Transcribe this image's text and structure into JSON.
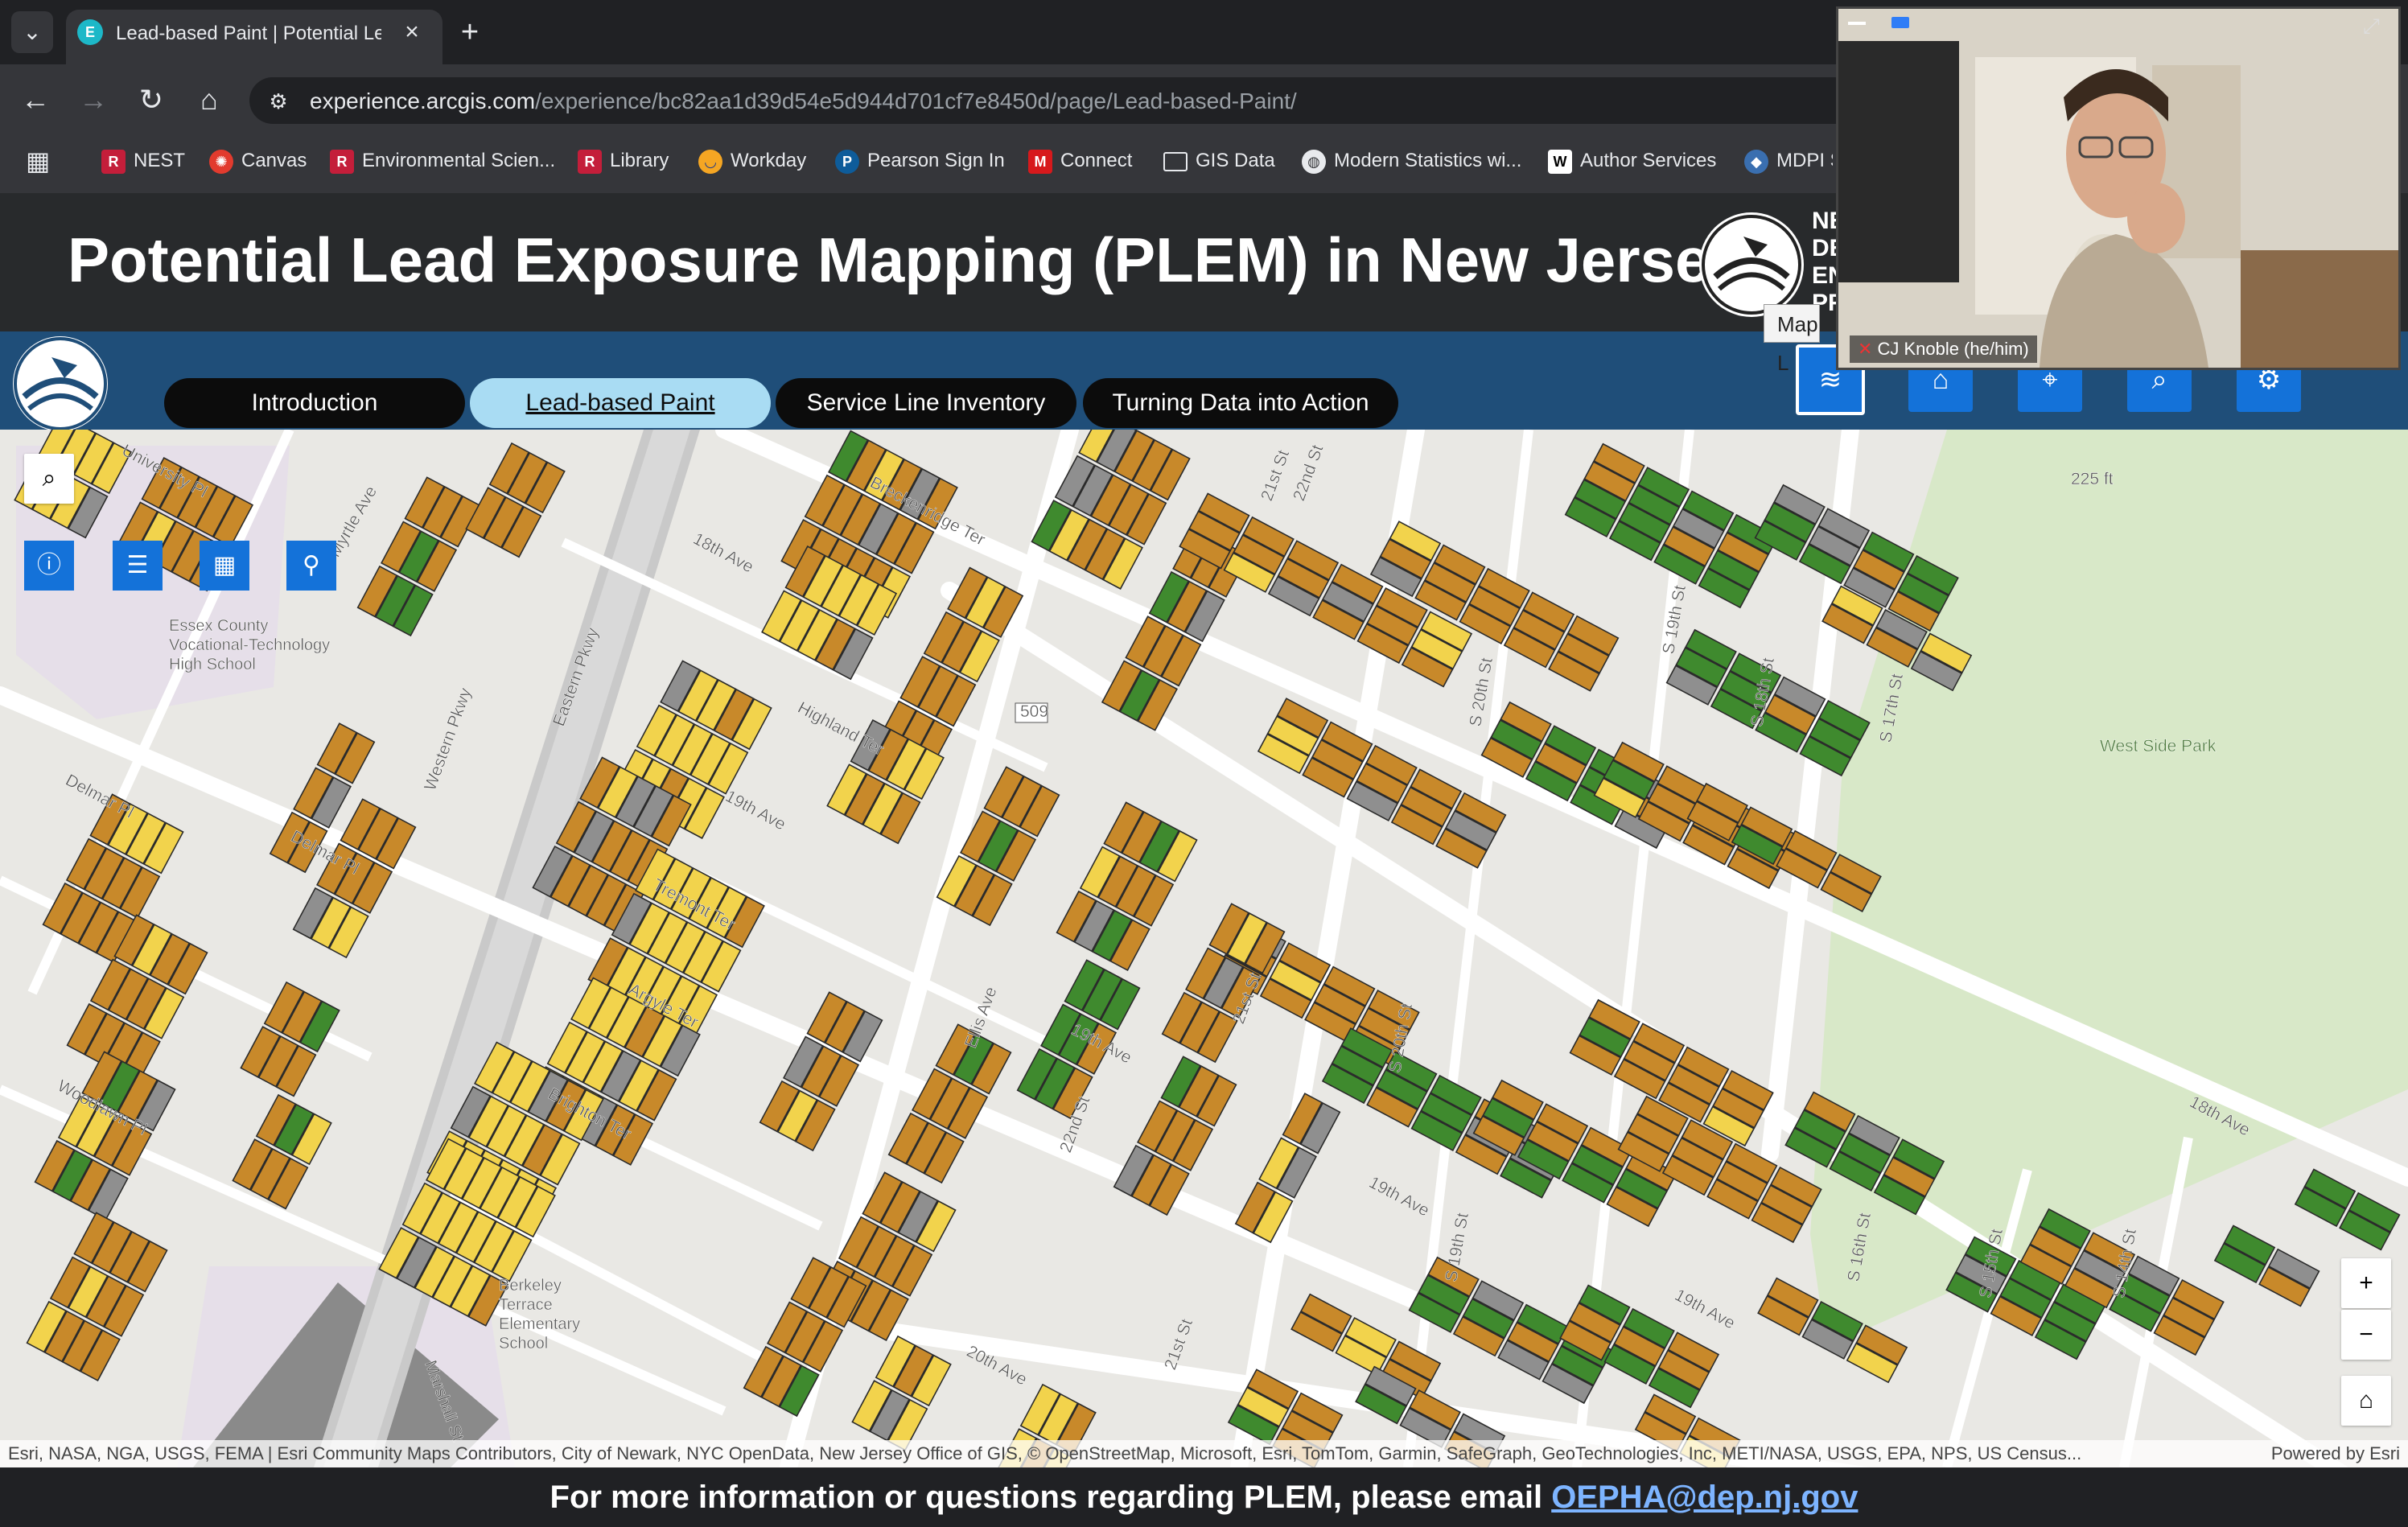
{
  "browser": {
    "tab_title": "Lead-based Paint | Potential Lea",
    "url_host": "experience.arcgis.com",
    "url_path": "/experience/bc82aa1d39d54e5d944d701cf7e8450d/page/Lead-based-Paint/",
    "bookmarks": [
      "NEST",
      "Canvas",
      "Environmental Scien...",
      "Library",
      "Workday",
      "Pearson Sign In",
      "Connect",
      "GIS Data",
      "Modern Statistics wi...",
      "Author Services",
      "MDPI S"
    ]
  },
  "app": {
    "title": "Potential Lead Exposure Mapping (PLEM) in New Jersey",
    "logo_text": [
      "NE",
      "DE",
      "EN",
      "PR"
    ],
    "tabs": [
      "Introduction",
      "Lead-based Paint",
      "Service Line Inventory",
      "Turning Data into Action"
    ],
    "tooltip": "Map L"
  },
  "map": {
    "labels": [
      "University Pl",
      "Myrtle Ave",
      "Essex County Vocational-Technology High School",
      "18th Ave",
      "Breckenridge Ter",
      "Highland Ter",
      "Eastern Pkwy",
      "Western Pkwy",
      "Delmar Pl",
      "Delmar Pl",
      "19th Ave",
      "Tremont Ter",
      "Argyle Ter",
      "Brighton Ter",
      "Woodlawn Pl",
      "Berkeley Terrace Elementary School",
      "Marshall St",
      "20th Ave",
      "Ellis Ave",
      "19th Ave",
      "22nd St",
      "21st St",
      "21st St",
      "S 20th St",
      "S 20th St",
      "19th Ave",
      "S 19th St",
      "22nd St",
      "21st St",
      "S 19th St",
      "S 18th St",
      "S 17th St",
      "West Side Park",
      "225 ft",
      "18th Ave",
      "19th Ave",
      "S 16th St",
      "S 15th St",
      "S 14th St",
      "509"
    ],
    "attribution": "Esri, NASA, NGA, USGS, FEMA | Esri Community Maps Contributors, City of Newark, NYC OpenData, New Jersey Office of GIS, © OpenStreetMap, Microsoft, Esri, TomTom, Garmin, SafeGraph, GeoTechnologies, Inc, METI/NASA, USGS, EPA, NPS, US Census...",
    "powered_by": "Powered by Esri",
    "colors": {
      "orange": "#c8892a",
      "yellow": "#f2d34c",
      "green": "#3f8a2e",
      "gray": "#8f8f8f"
    }
  },
  "footer": {
    "text": "For more information or questions regarding PLEM, please email ",
    "email": "OEPHA@dep.nj.gov"
  },
  "video": {
    "participant": "CJ Knoble (he/him)"
  }
}
